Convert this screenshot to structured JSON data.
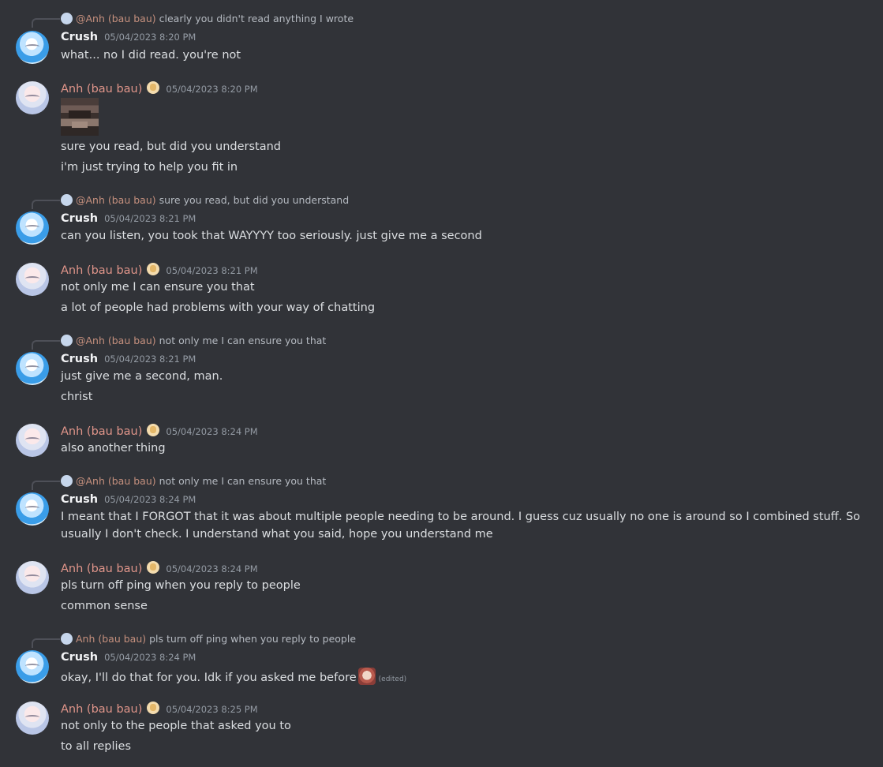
{
  "m1": {
    "reply": {
      "name": "@Anh (bau bau)",
      "text": "clearly you didn't read anything I wrote"
    },
    "author": "Crush",
    "time": "05/04/2023 8:20 PM",
    "lines": [
      "what... no I did read. you're not"
    ]
  },
  "m2": {
    "author": "Anh (bau bau)",
    "time": "05/04/2023 8:20 PM",
    "lines": [
      "sure you read, but did you understand",
      "i'm just trying to help you fit in"
    ]
  },
  "m3": {
    "reply": {
      "name": "@Anh (bau bau)",
      "text": "sure you read, but did you understand"
    },
    "author": "Crush",
    "time": "05/04/2023 8:21 PM",
    "lines": [
      "can you listen, you took that WAYYYY too seriously. just give me a second"
    ]
  },
  "m4": {
    "author": "Anh (bau bau)",
    "time": "05/04/2023 8:21 PM",
    "lines": [
      "not only me I can ensure you that",
      "a lot of people had problems with your way of chatting"
    ]
  },
  "m5": {
    "reply": {
      "name": "@Anh (bau bau)",
      "text": "not only me I can ensure you that"
    },
    "author": "Crush",
    "time": "05/04/2023 8:21 PM",
    "lines": [
      "just give me a second, man.",
      "christ"
    ]
  },
  "m6": {
    "author": "Anh (bau bau)",
    "time": "05/04/2023 8:24 PM",
    "lines": [
      "also another thing"
    ]
  },
  "m7": {
    "reply": {
      "name": "@Anh (bau bau)",
      "text": "not only me I can ensure you that"
    },
    "author": "Crush",
    "time": "05/04/2023 8:24 PM",
    "lines": [
      "I meant that I FORGOT  that it was about multiple people needing to be around. I guess cuz usually no one is around so I combined stuff. So usually I don't check. I understand what you said, hope you understand me"
    ]
  },
  "m8": {
    "author": "Anh (bau bau)",
    "time": "05/04/2023 8:24 PM",
    "lines": [
      "pls turn off ping when you reply to people",
      "common sense"
    ]
  },
  "m9": {
    "reply": {
      "name": "Anh (bau bau)",
      "text": "pls turn off ping when you reply to people"
    },
    "author": "Crush",
    "time": "05/04/2023 8:24 PM",
    "lines": [
      "okay, I'll do that for you. Idk if you asked me before"
    ],
    "edited": "(edited)"
  },
  "m10": {
    "author": "Anh (bau bau)",
    "time": "05/04/2023 8:25 PM",
    "lines": [
      "not only to the people that asked you to",
      "to all replies"
    ]
  }
}
